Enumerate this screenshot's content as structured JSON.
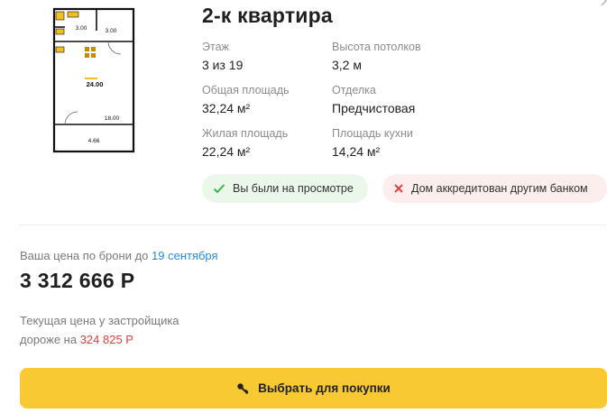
{
  "listing": {
    "title": "2-к квартира",
    "specs": [
      {
        "label": "Этаж",
        "value": "3 из 19"
      },
      {
        "label": "Высота потолков",
        "value": "3,2 м"
      },
      {
        "label": "Общая площадь",
        "value": "32,24 м²"
      },
      {
        "label": "Отделка",
        "value": "Предчистовая"
      },
      {
        "label": "Жилая площадь",
        "value": "22,24 м²"
      },
      {
        "label": "Площадь кухни",
        "value": "14,24 м²"
      }
    ],
    "badges": {
      "viewed": "Вы были на просмотре",
      "accredited": "Дом аккредитован другим банком"
    }
  },
  "floorplan": {
    "labels": {
      "room_a": "3.00",
      "room_b": "3.00",
      "main_room": "24.00",
      "room_c": "18.00",
      "balcony": "4.66"
    }
  },
  "pricing": {
    "reserve_prefix": "Ваша цена по брони до",
    "reserve_date": "19 сентября",
    "price": "3 312 666 Р",
    "note_line1": "Текущая цена у застройщика",
    "note_prefix": "дороже на",
    "note_diff": "324 825 Р"
  },
  "actions": {
    "buy_label": "Выбрать для покупки"
  },
  "colors": {
    "accent_yellow": "#f9c933",
    "link_blue": "#2a8be0",
    "danger_red": "#e0413e",
    "success_green": "#3bb54a"
  },
  "icons": {
    "chevron": "chevron-right-icon",
    "check": "check-icon",
    "cross": "close-icon",
    "key": "key-icon"
  }
}
